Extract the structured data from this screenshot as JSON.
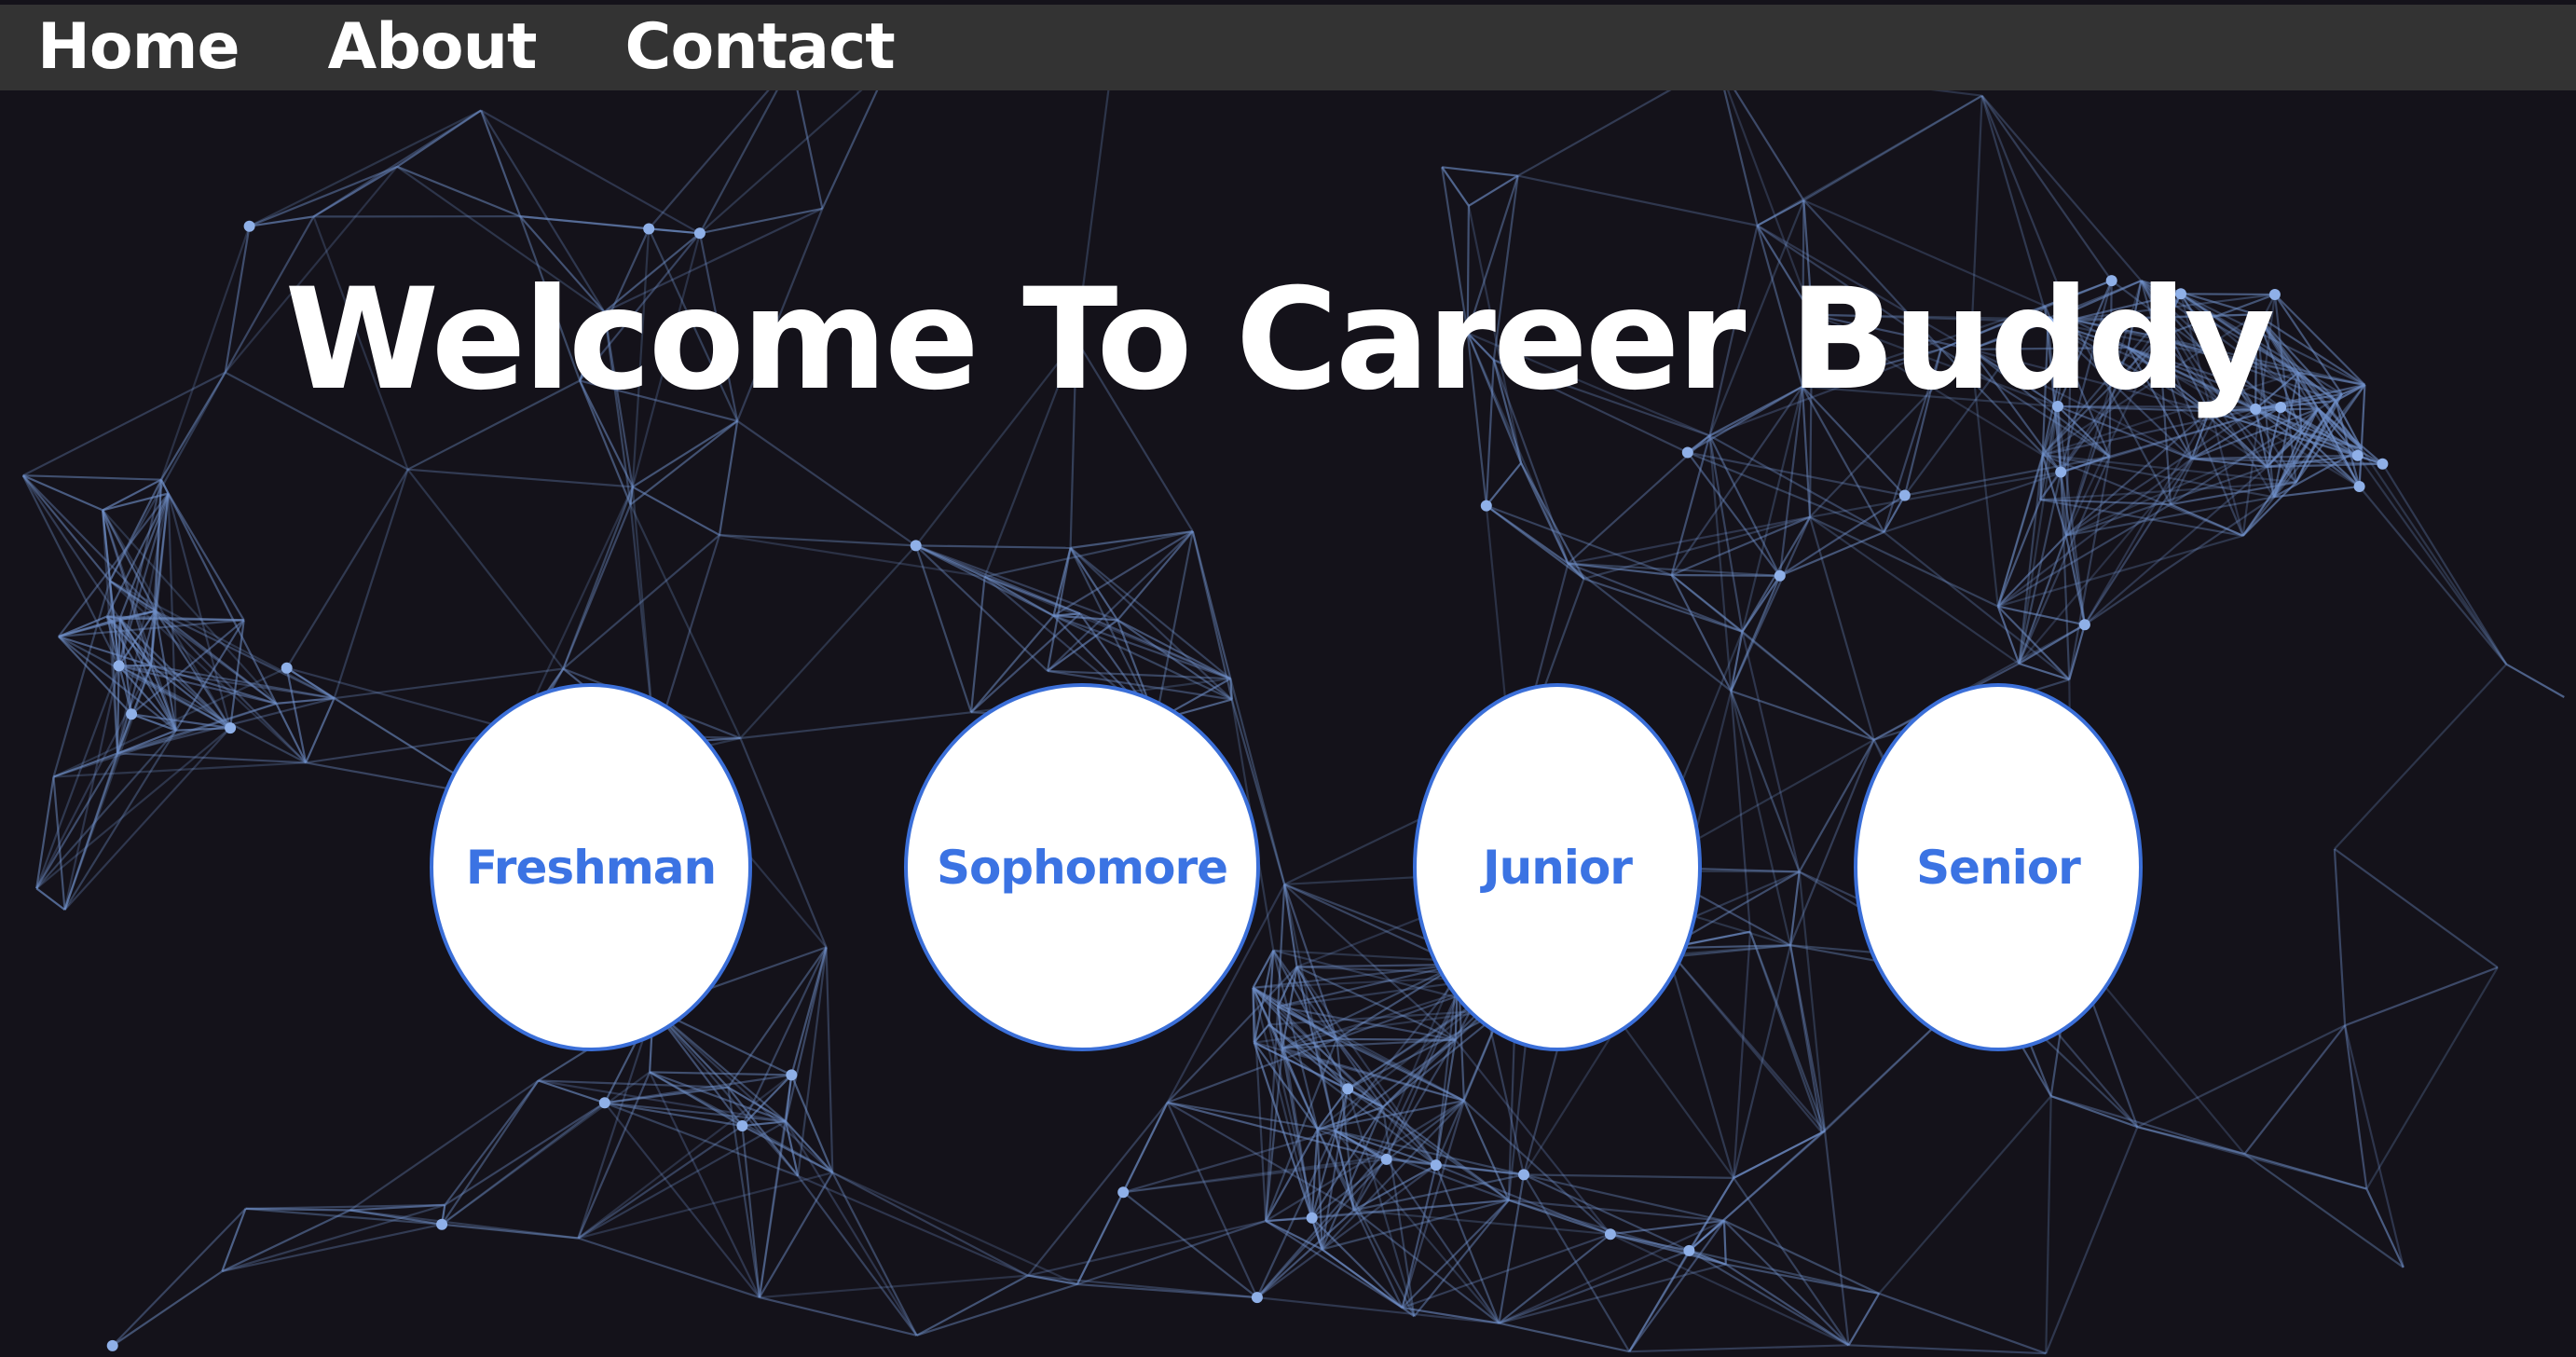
{
  "nav": {
    "items": [
      {
        "label": "Home"
      },
      {
        "label": "About"
      },
      {
        "label": "Contact"
      }
    ]
  },
  "hero": {
    "title": "Welcome To Career Buddy"
  },
  "years": [
    {
      "label": "Freshman"
    },
    {
      "label": "Sophomore"
    },
    {
      "label": "Junior"
    },
    {
      "label": "Senior"
    }
  ],
  "colors": {
    "background": "#14121a",
    "navbar": "#333333",
    "network_lines": "#6f8fc8",
    "circle_fill": "#ffffff",
    "circle_border": "#3b6fd8",
    "circle_text": "#3b73e3",
    "title_text": "#ffffff"
  },
  "icons": {
    "background": "particle-network-background"
  }
}
